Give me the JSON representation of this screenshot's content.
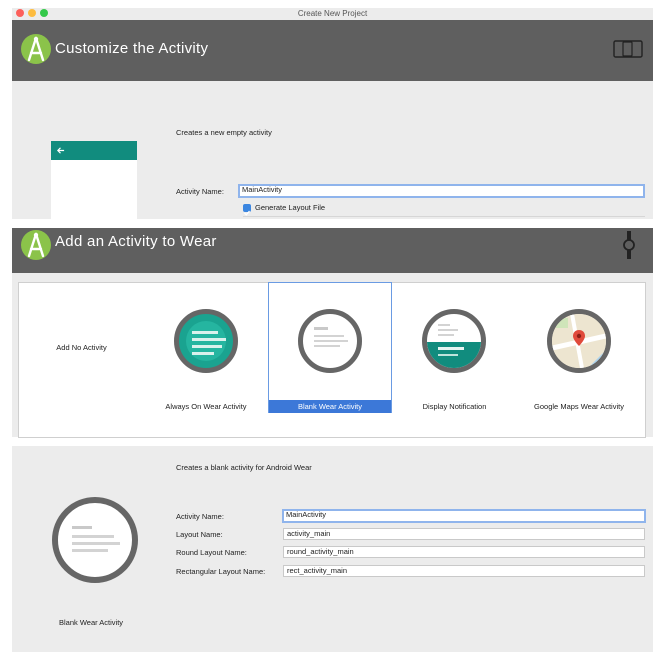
{
  "window": {
    "title": "Create New Project"
  },
  "section1": {
    "header_title": "Customize the Activity",
    "description": "Creates a new empty activity",
    "activity_name_label": "Activity Name:",
    "activity_name_value": "MainActivity",
    "generate_layout_label": "Generate Layout File"
  },
  "section2": {
    "header_title": "Add an Activity to Wear",
    "templates": [
      {
        "label": "Add No Activity"
      },
      {
        "label": "Always On Wear Activity"
      },
      {
        "label": "Blank Wear Activity",
        "selected": true
      },
      {
        "label": "Display Notification"
      },
      {
        "label": "Google Maps Wear Activity"
      }
    ]
  },
  "section3": {
    "description": "Creates a blank activity for Android Wear",
    "preview_label": "Blank Wear Activity",
    "fields": [
      {
        "label": "Activity Name:",
        "value": "MainActivity"
      },
      {
        "label": "Layout Name:",
        "value": "activity_main"
      },
      {
        "label": "Round Layout Name:",
        "value": "round_activity_main"
      },
      {
        "label": "Rectangular Layout Name:",
        "value": "rect_activity_main"
      }
    ]
  },
  "colors": {
    "header": "#5f5f5f",
    "accent_teal": "#118c7e",
    "selection_blue": "#3c78d8",
    "android_green": "#8bc34a"
  },
  "icons": [
    "android-studio-logo-icon",
    "device-frame-icon",
    "wear-watch-icon",
    "back-arrow-icon",
    "map-pin-icon"
  ]
}
